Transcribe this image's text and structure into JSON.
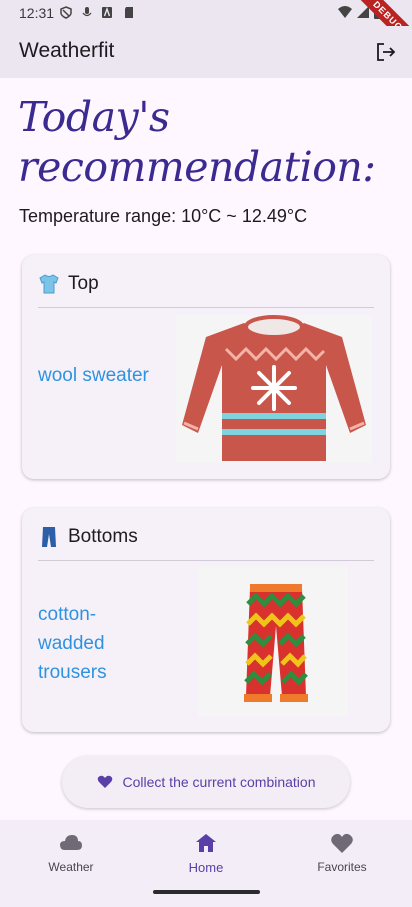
{
  "status_bar": {
    "time": "12:31"
  },
  "debug_banner": "DEBUG",
  "app_bar": {
    "title": "Weatherfit"
  },
  "headline": "Today's recommendation:",
  "temperature_range": "Temperature range: 10°C ~ 12.49°C",
  "cards": [
    {
      "heading": "Top",
      "item": "wool sweater"
    },
    {
      "heading": "Bottoms",
      "item": "cotton-wadded trousers"
    }
  ],
  "collect_button": {
    "label": "Collect the current combination"
  },
  "nav": {
    "items": [
      {
        "label": "Weather",
        "icon": "cloud-icon"
      },
      {
        "label": "Home",
        "icon": "home-icon"
      },
      {
        "label": "Favorites",
        "icon": "heart-icon"
      }
    ],
    "active": "Home"
  },
  "colors": {
    "accent": "#5a3fa8",
    "link": "#2f92e0",
    "headline": "#3b2a8f",
    "appbar": "#ebe6f0"
  }
}
